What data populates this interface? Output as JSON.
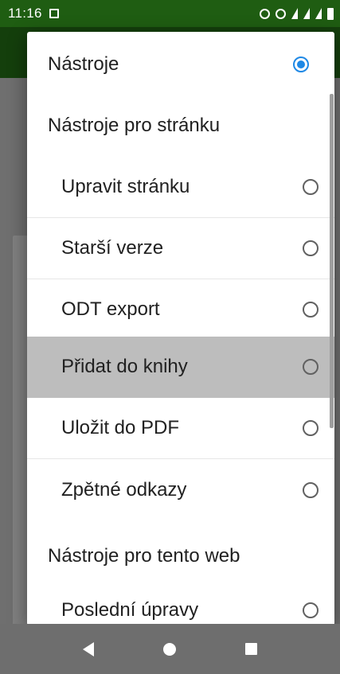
{
  "status_bar": {
    "time": "11:16"
  },
  "dialog": {
    "top_item": {
      "label": "Nástroje",
      "selected": true
    },
    "section_page": "Nástroje pro stránku",
    "items": [
      {
        "label": "Upravit stránku",
        "selected": false
      },
      {
        "label": "Starší verze",
        "selected": false
      },
      {
        "label": "ODT export",
        "selected": false
      },
      {
        "label": "Přidat do knihy",
        "selected": false,
        "highlighted": true
      },
      {
        "label": "Uložit do PDF",
        "selected": false
      },
      {
        "label": "Zpětné odkazy",
        "selected": false
      }
    ],
    "section_web": "Nástroje pro tento web",
    "web_items": [
      {
        "label": "Poslední úpravy",
        "selected": false
      }
    ]
  },
  "colors": {
    "status_bar": "#1f5d12",
    "radio_checked": "#1e88e5",
    "highlight": "#bdbdbd"
  }
}
